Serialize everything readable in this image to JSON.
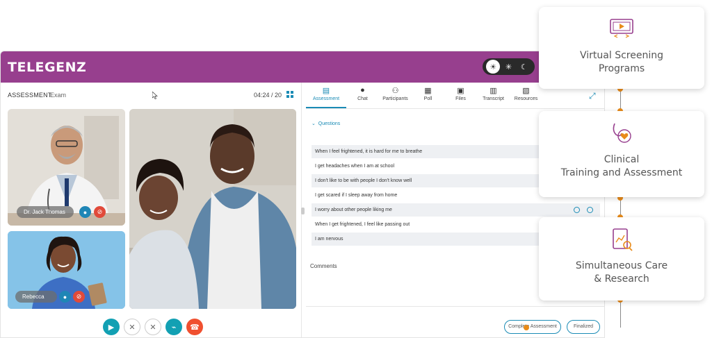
{
  "app": {
    "logo": "TELEGENZ",
    "theme_options": [
      "sun-icon",
      "sparkle-icon",
      "moon-icon"
    ]
  },
  "left": {
    "title": "ASSESSMENT",
    "subtitle": "Exam",
    "timer": "04:24 / 20",
    "participants": [
      {
        "name": "Dr. Jack Thomas"
      },
      {
        "name": "Rebecca"
      }
    ],
    "controls": [
      "video-icon",
      "mic-off-icon",
      "hand-off-icon",
      "attachment-icon",
      "phone-icon"
    ]
  },
  "right": {
    "tabs": [
      {
        "label": "Assessment",
        "icon": "document-icon",
        "active": true
      },
      {
        "label": "Chat",
        "icon": "chat-icon"
      },
      {
        "label": "Participants",
        "icon": "people-icon"
      },
      {
        "label": "Poll",
        "icon": "poll-icon"
      },
      {
        "label": "Files",
        "icon": "files-icon"
      },
      {
        "label": "Transcript",
        "icon": "transcript-icon"
      },
      {
        "label": "Resources",
        "icon": "resources-icon"
      }
    ],
    "questions_header": "Questions",
    "questions": [
      "When I feel frightened, it is hard for me to breathe",
      "I get headaches when I am at school",
      "I don't like to be with people I don't know well",
      "I get scared if I sleep away from home",
      "I worry about other people liking me",
      "When I get frightened, I feel like passing out",
      "I am nervous"
    ],
    "comments_label": "Comments",
    "complete_button": "Complete Assessment",
    "finalized_button": "Finalized"
  },
  "cards": [
    {
      "title": "Virtual Screening Programs",
      "line1": "Virtual Screening",
      "line2": "Programs"
    },
    {
      "title": "Clinical Training and Assessment",
      "line1": "Clinical",
      "line2": "Training and Assessment"
    },
    {
      "title": "Simultaneous Care & Research",
      "line1": "Simultaneous Care",
      "line2": "& Research"
    }
  ],
  "colors": {
    "brand_purple": "#973f8e",
    "accent_blue": "#1a8bb5",
    "accent_orange": "#e88b1a"
  }
}
